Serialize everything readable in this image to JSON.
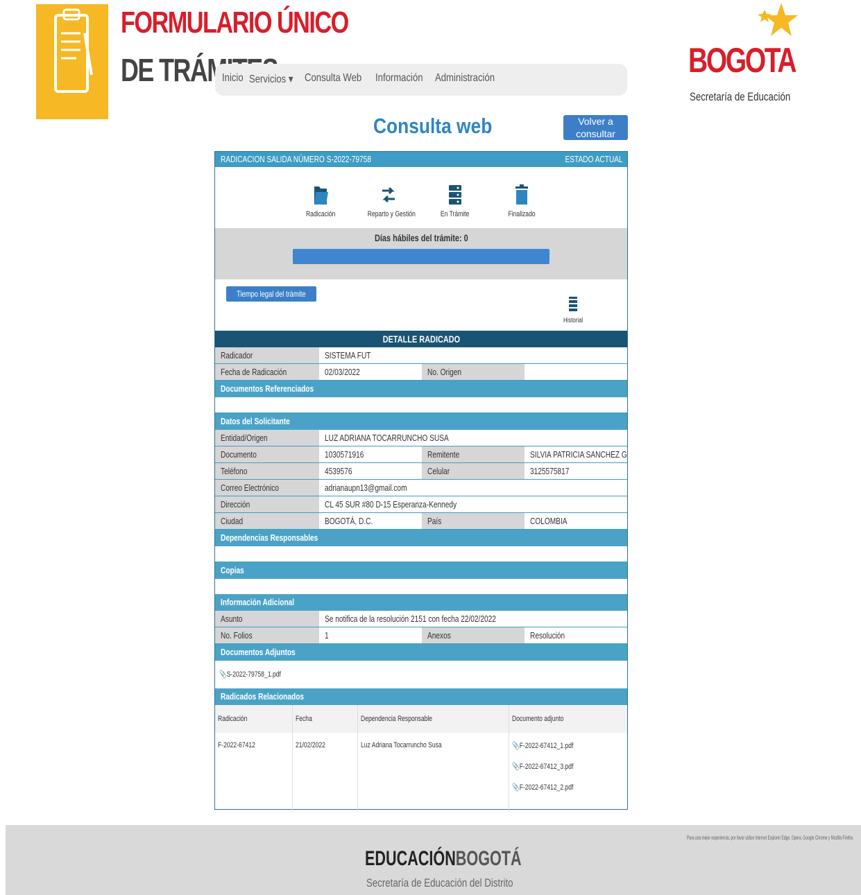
{
  "header": {
    "title_line1": "FORMULARIO ÚNICO",
    "title_line2": "DE TRÁMITES",
    "nav": [
      "Inicio",
      "Servicios ▾",
      "Consulta Web",
      "Información",
      "Administración"
    ],
    "bogota_word": "BOGOTA",
    "bogota_sub": "Secretaría de Educación"
  },
  "page": {
    "title": "Consulta web",
    "volver_label": "Volver a consultar"
  },
  "status": {
    "radicacion_label": "RADICACION SALIDA NÚMERO S-2022-79758",
    "estado_label": "ESTADO ACTUAL",
    "steps": [
      "Radicación",
      "Reparto y Gestión",
      "En Trámite",
      "Finalizado"
    ],
    "dias_label": "Días hábiles del trámite: 0",
    "progress_fraction": 1.0,
    "tiempo_btn": "Tiempo legal del trámite",
    "historial": "Historial"
  },
  "detalle": {
    "header": "DETALLE RADICADO",
    "radicador_label": "Radicador",
    "radicador_value": "SISTEMA FUT",
    "fecha_label": "Fecha de Radicación",
    "fecha_value": "02/03/2022",
    "origen_label": "No. Origen",
    "origen_value": "",
    "docs_ref": "Documentos Referenciados",
    "solicitante": "Datos del Solicitante",
    "entidad_label": "Entidad/Origen",
    "entidad_value": "LUZ ADRIANA TOCARRUNCHO SUSA",
    "documento_label": "Documento",
    "documento_value": "1030571916",
    "remitente_label": "Remitente",
    "remitente_value": "SILVIA PATRICIA SANCHEZ GUEVARA",
    "telefono_label": "Teléfono",
    "telefono_value": "4539576",
    "celular_label": "Celular",
    "celular_value": "3125575817",
    "correo_label": "Correo Electrónico",
    "correo_value": "adrianaupn13@gmail.com",
    "direccion_label": "Dirección",
    "direccion_value": "CL 45 SUR #80 D-15 Esperanza-Kennedy",
    "ciudad_label": "Ciudad",
    "ciudad_value": "BOGOTÁ, D.C.",
    "pais_label": "País",
    "pais_value": "COLOMBIA",
    "dependencias": "Dependencias Responsables",
    "copias": "Copias",
    "info_adicional": "Información Adicional",
    "asunto_label": "Asunto",
    "asunto_value": "Se notifica de la resolución 2151 con fecha 22/02/2022",
    "folios_label": "No. Folios",
    "folios_value": "1",
    "anexos_label": "Anexos",
    "anexos_value": "Resolución",
    "docs_adjuntos": "Documentos Adjuntos",
    "adjunto_file": "S-2022-79758_1.pdf",
    "relacionados": "Radicados Relacionados"
  },
  "relacionados_table": {
    "headers": [
      "Radicación",
      "Fecha",
      "Dependencia Responsable",
      "Documento adjunto"
    ],
    "row": {
      "radicacion": "F-2022-67412",
      "fecha": "21/02/2022",
      "dependencia": "Luz Adriana Tocarruncho Susa",
      "files": [
        "F-2022-67412_1.pdf",
        "F-2022-67412_3.pdf",
        "F-2022-67412_2.pdf"
      ]
    }
  },
  "footer": {
    "brand_a": "EDUCACIÓN",
    "brand_b": "BOGOTÁ",
    "sub": "Secretaría de Educación del Distrito",
    "note": "Para una mejor experiencia, por favor utilice Internet Explorer Edge, Opera, Google Chrome y Mozilla Firefox"
  },
  "colors": {
    "accent": "#3f9cc4",
    "dark_header": "#1a5474",
    "brand_red": "#d81e2a",
    "logo_yellow": "#f7b825"
  }
}
